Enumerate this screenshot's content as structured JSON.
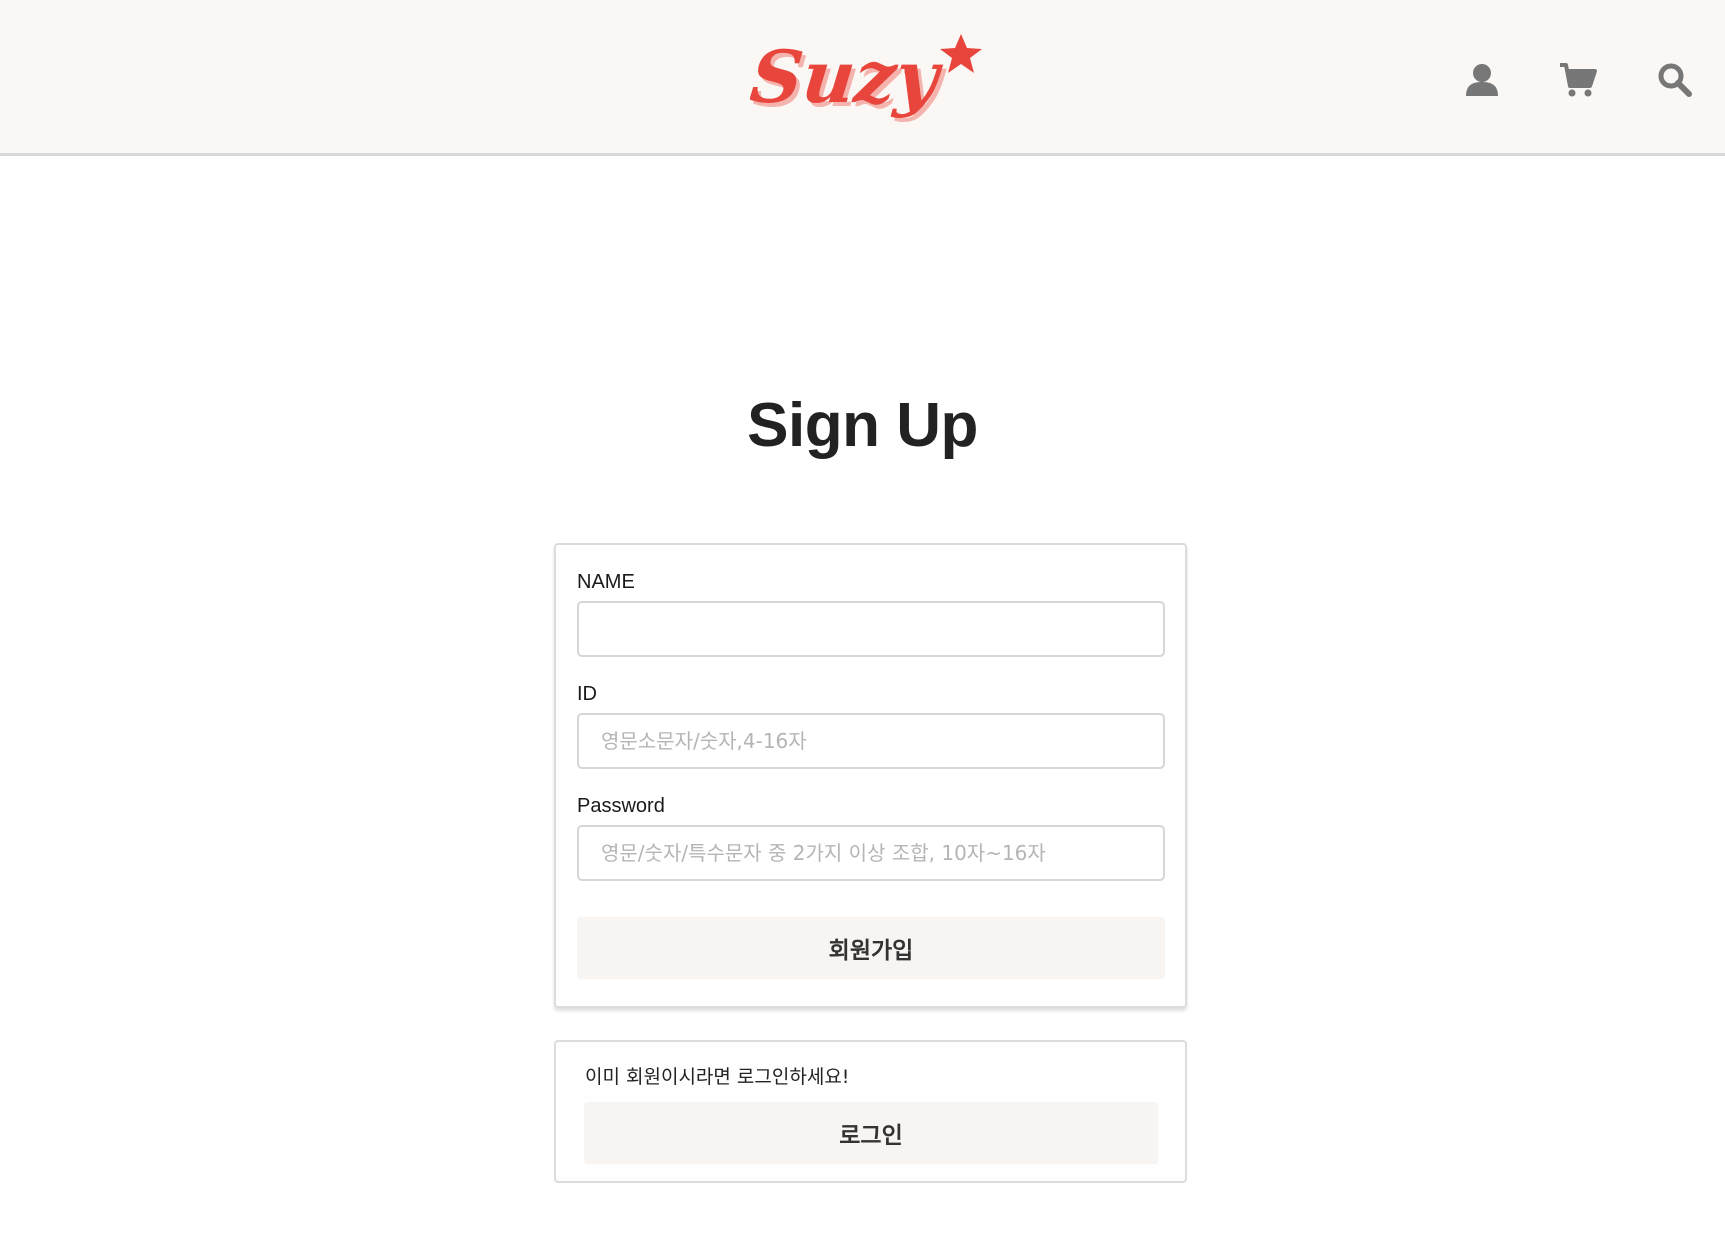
{
  "header": {
    "logo_text": "Suzy",
    "icons": [
      "user-icon",
      "cart-icon",
      "search-icon"
    ]
  },
  "page": {
    "title": "Sign Up"
  },
  "form": {
    "name_label": "NAME",
    "name_value": "",
    "id_label": "ID",
    "id_placeholder": "영문소문자/숫자,4-16자",
    "password_label": "Password",
    "password_placeholder": "영문/숫자/특수문자 중 2가지 이상 조합, 10자~16자",
    "submit_label": "회원가입"
  },
  "login_box": {
    "prompt": "이미 회원이시라면 로그인하세요!",
    "button_label": "로그인"
  },
  "colors": {
    "header_bg": "#faf7f4",
    "logo_red": "#e8463c",
    "button_bg": "#f7f4f1",
    "icon_gray": "#777777"
  }
}
